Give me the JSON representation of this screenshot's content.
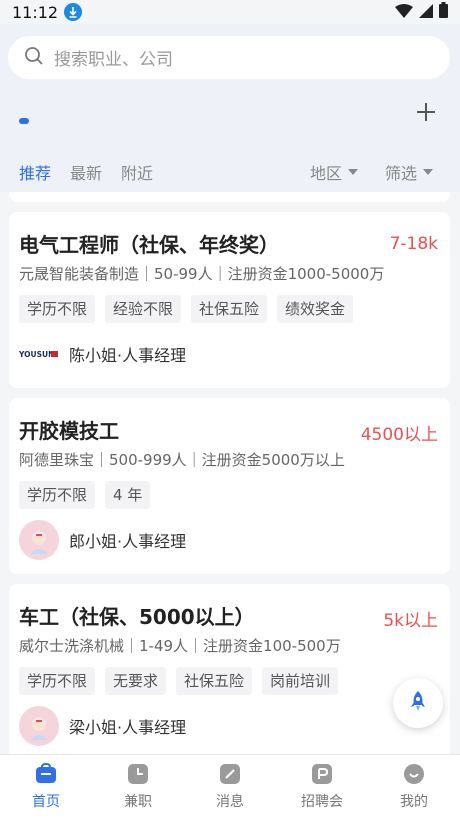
{
  "status": {
    "time": "11:12"
  },
  "search": {
    "placeholder": "搜索职业、公司"
  },
  "tabs": [
    {
      "label": "推荐",
      "active": true
    },
    {
      "label": "最新",
      "active": false
    },
    {
      "label": "附近",
      "active": false
    }
  ],
  "filters": {
    "region": "地区",
    "filter": "筛选"
  },
  "jobs": [
    {
      "title": "电气工程师（社保、年终奖）",
      "salary": "7-18k",
      "company": "元晟智能装备制造｜50-99人｜注册资金1000-5000万",
      "tags": [
        "学历不限",
        "经验不限",
        "社保五险",
        "绩效奖金"
      ],
      "recruiter": "陈小姐·人事经理",
      "logo_text": "YOUSUN"
    },
    {
      "title": "开胶模技工",
      "salary": "4500以上",
      "company": "阿德里珠宝｜500-999人｜注册资金5000万以上",
      "tags": [
        "学历不限",
        "4 年"
      ],
      "recruiter": "郎小姐·人事经理"
    },
    {
      "title": "车工（社保、5000以上）",
      "salary": "5k以上",
      "company": "威尔士洗涤机械｜1-49人｜注册资金100-500万",
      "tags": [
        "学历不限",
        "无要求",
        "社保五险",
        "岗前培训"
      ],
      "recruiter": "梁小姐·人事经理"
    }
  ],
  "nav": [
    {
      "label": "首页",
      "icon": "home-icon",
      "active": true
    },
    {
      "label": "兼职",
      "icon": "clock-icon",
      "active": false
    },
    {
      "label": "消息",
      "icon": "message-icon",
      "active": false
    },
    {
      "label": "招聘会",
      "icon": "job-fair-icon",
      "active": false
    },
    {
      "label": "我的",
      "icon": "profile-icon",
      "active": false
    }
  ],
  "colors": {
    "accent": "#2f6fe8",
    "salary": "#ef4e4e"
  }
}
